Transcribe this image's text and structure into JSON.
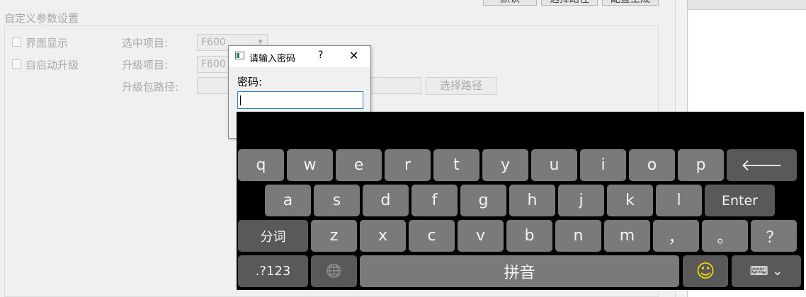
{
  "toolbar": {
    "btn_default": "默认",
    "btn_select_path": "选择路径",
    "btn_config": "配置生成"
  },
  "group": {
    "title": "自定义参数设置",
    "checkbox_display": "界面显示",
    "checkbox_autoupgrade": "自启动升级",
    "selected_item_label": "选中项目:",
    "selected_item_value": "F600",
    "upgrade_item_label": "升级项目:",
    "upgrade_item_value": "F600",
    "package_path_label": "升级包路径:",
    "select_path_button": "选择路径"
  },
  "dialog": {
    "title": "请输入密码",
    "help": "?",
    "close": "✕",
    "password_label": "密码:"
  },
  "keyboard": {
    "row1": [
      "q",
      "w",
      "e",
      "r",
      "t",
      "y",
      "u",
      "i",
      "o",
      "p"
    ],
    "backspace": "🡐",
    "row2": [
      "a",
      "s",
      "d",
      "f",
      "g",
      "h",
      "j",
      "k",
      "l"
    ],
    "enter": "Enter",
    "segment": "分词",
    "row3": [
      "z",
      "x",
      "c",
      "v",
      "b",
      "n",
      "m",
      "，",
      "。",
      "？"
    ],
    "symbols": ".?123",
    "globe": "🌐",
    "space": "拼音",
    "emoji": "☺",
    "emoji_color": "#f5d800",
    "hide": "⌨ ⌄"
  }
}
